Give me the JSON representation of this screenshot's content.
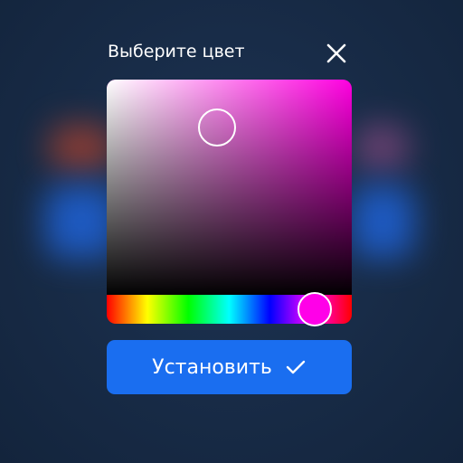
{
  "dialog": {
    "title": "Выберите цвет",
    "close_icon": "close-icon"
  },
  "picker": {
    "hue_color": "#ff00e0",
    "hue_value": 0.85,
    "saturation": 0.45,
    "brightness": 0.78,
    "selected_color": "#ff00e8"
  },
  "apply_button": {
    "label": "Установить",
    "icon": "checkmark-icon",
    "color": "#1a6ef0"
  },
  "background": {
    "color": "#172a45"
  }
}
